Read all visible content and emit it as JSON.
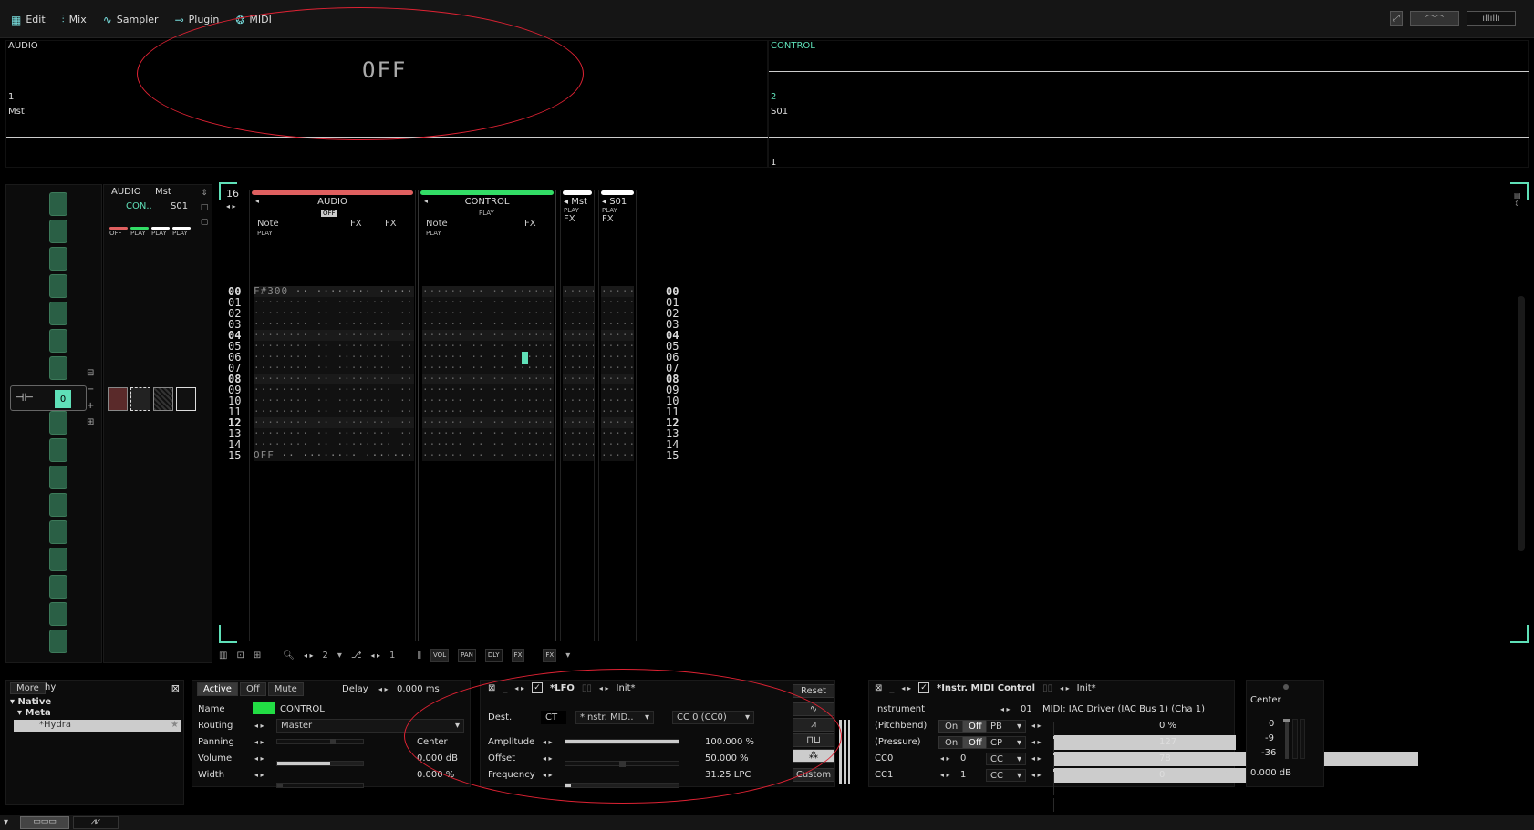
{
  "menu": [
    {
      "icon": "grid-icon",
      "label": "Edit"
    },
    {
      "icon": "sliders-icon",
      "label": "Mix"
    },
    {
      "icon": "wave-icon",
      "label": "Sampler"
    },
    {
      "icon": "plug-icon",
      "label": "Plugin"
    },
    {
      "icon": "midi-icon",
      "label": "MIDI"
    }
  ],
  "scopes": {
    "audio_label": "AUDIO",
    "off_text": "OFF",
    "audio_num": "1",
    "mst_label": "Mst",
    "control_label": "CONTROL",
    "control_num": "2",
    "s01_label": "S01",
    "s01_num": "1"
  },
  "tracklist": {
    "col1": "AUDIO",
    "col2": "Mst",
    "col3": "CON..",
    "col4": "S01",
    "btn_off": "OFF",
    "btn_play": "PLAY",
    "stepper_value": "0"
  },
  "pattern": {
    "length": "16",
    "tracks": [
      {
        "name": "AUDIO",
        "color": "#e06060",
        "state": "OFF",
        "cols": [
          "Note",
          "FX",
          "FX"
        ],
        "sub": "PLAY"
      },
      {
        "name": "CONTROL",
        "color": "#33dd66",
        "state": "PLAY",
        "cols": [
          "Note",
          "FX"
        ],
        "sub": "PLAY"
      },
      {
        "name": "Mst",
        "color": "#ffffff",
        "state": "PLAY",
        "cols": [
          "FX"
        ]
      },
      {
        "name": "S01",
        "color": "#ffffff",
        "state": "PLAY",
        "cols": [
          "FX"
        ]
      }
    ],
    "rows": [
      "00",
      "01",
      "02",
      "03",
      "04",
      "05",
      "06",
      "07",
      "08",
      "09",
      "10",
      "11",
      "12",
      "13",
      "14",
      "15"
    ],
    "first_note": "F#300",
    "last_note": "OFF"
  },
  "toolbar": {
    "step_value": "2",
    "octave_value": "1",
    "vol": "VOL",
    "pan": "PAN",
    "dly": "DLY",
    "fx": "FX",
    "fx2": "FX"
  },
  "browser": {
    "more": "More",
    "search": "hy",
    "native": "Native",
    "meta": "Meta",
    "item": "*Hydra"
  },
  "mixer": {
    "active": "Active",
    "off": "Off",
    "mute": "Mute",
    "delay_label": "Delay",
    "delay_value": "0.000 ms",
    "name_label": "Name",
    "name_value": "CONTROL",
    "routing_label": "Routing",
    "routing_value": "Master",
    "panning_label": "Panning",
    "panning_value": "Center",
    "volume_label": "Volume",
    "volume_value": "0.000 dB",
    "width_label": "Width",
    "width_value": "0.000 %",
    "volume_level": 0.62
  },
  "lfo": {
    "title": "*LFO",
    "preset": "Init*",
    "dest_label": "Dest.",
    "dest_ct": "CT",
    "dest_instr": "*Instr. MID..",
    "dest_cc": "CC 0 (CC0)",
    "amp_label": "Amplitude",
    "amp_value": "100.000 %",
    "amp_level": 1.0,
    "offset_label": "Offset",
    "offset_value": "50.000 %",
    "offset_level": 0.5,
    "freq_label": "Frequency",
    "freq_value": "31.25 LPC",
    "freq_level": 0.05,
    "reset": "Reset",
    "custom": "Custom"
  },
  "midi": {
    "title": "*Instr. MIDI Control",
    "preset": "Init*",
    "instrument_label": "Instrument",
    "instrument_num": "01",
    "instrument_value": "MIDI: IAC Driver (IAC Bus 1) (Cha 1)",
    "rows": [
      {
        "label": "(Pitchbend)",
        "on": "On",
        "off": "Off",
        "type": "PB",
        "value": "0 %",
        "level": 0.5
      },
      {
        "label": "(Pressure)",
        "on": "On",
        "off": "Off",
        "type": "CP",
        "value": "127",
        "level": 1.0
      },
      {
        "label": "CC0",
        "num": "0",
        "type": "CC",
        "value": "78",
        "level": 0.61
      },
      {
        "label": "CC1",
        "num": "1",
        "type": "CC",
        "value": "0",
        "level": 0.0
      }
    ]
  },
  "master": {
    "center": "Center",
    "t0": "0",
    "t9": "-9",
    "t36": "-36",
    "db": "0.000 dB"
  }
}
